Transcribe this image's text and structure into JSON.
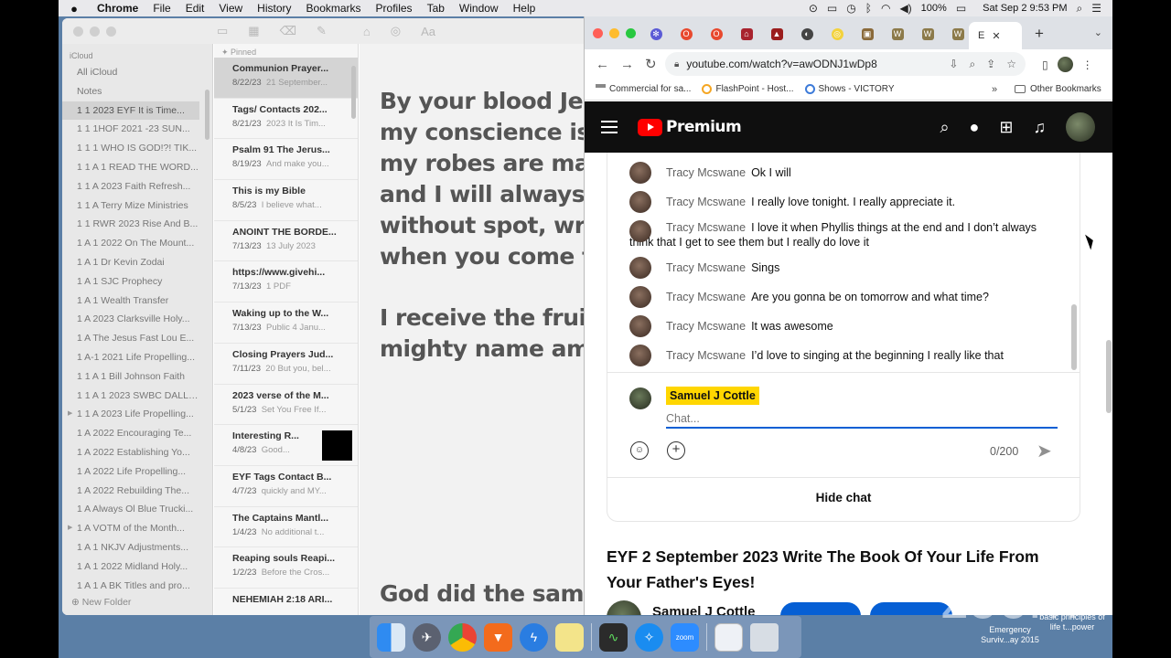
{
  "menubar": {
    "app": "Chrome",
    "menus": [
      "File",
      "Edit",
      "View",
      "History",
      "Bookmarks",
      "Profiles",
      "Tab",
      "Window",
      "Help"
    ],
    "battery": "100%",
    "datetime": "Sat Sep 2  9:53 PM"
  },
  "notes": {
    "account": "iCloud",
    "all_icloud": "All iCloud",
    "notes_folder": "Notes",
    "folders": [
      "1  1  2023 EYF  It is Time...",
      "1  1  1HOF 2021 -23 SUN...",
      "1  1  1 WHO IS GOD!?!  TIK...",
      "1  1 A   1 READ THE WORD...",
      "1  1 A  2023 Faith Refresh...",
      "1  1 A  Terry Mize Ministries",
      "1  1 RWR 2023 Rise And B...",
      "1  A  1 2022 On The Mount...",
      "1  A  1 Dr Kevin Zodai",
      "1  A  1 SJC Prophecy",
      "1  A  1 Wealth Transfer",
      "1  A  2023 Clarksville Holy...",
      "1  A  The Jesus Fast Lou E...",
      "1  A-1 2021 Life Propelling...",
      "1 1 A  1 Bill Johnson Faith",
      "1 1 A 1 2023 SWBC DALLAS",
      "1 1 A 2023 Life Propelling...",
      "1  A   2022 Encouraging Te...",
      "1  A   2022 Establishing Yo...",
      "1  A   2022 Life Propelling...",
      "1  A   2022 Rebuilding The...",
      "1  A   Always Ol Blue Trucki...",
      "1  A   VOTM of the Month...",
      "1  A  1   NKJV Adjustments...",
      "1  A  1   2022 Midland Holy...",
      "1  A  1  A BK Titles and pro..."
    ],
    "new_folder": "New Folder",
    "pinned_label": "Pinned",
    "list": [
      {
        "title": "Communion Prayer...",
        "date": "8/22/23",
        "preview": "21 September..."
      },
      {
        "title": "Tags/ Contacts 202...",
        "date": "8/21/23",
        "preview": "2023 It Is Tim..."
      },
      {
        "title": "Psalm 91 The Jerus...",
        "date": "8/19/23",
        "preview": "And make you..."
      },
      {
        "title": "This is my Bible",
        "date": "8/5/23",
        "preview": "I believe what..."
      },
      {
        "title": "ANOINT THE BORDE...",
        "date": "7/13/23",
        "preview": "13 July 2023"
      },
      {
        "title": "https://www.givehi...",
        "date": "7/13/23",
        "preview": "1 PDF"
      },
      {
        "title": "Waking up to the W...",
        "date": "7/13/23",
        "preview": "Public 4 Janu..."
      },
      {
        "title": "Closing Prayers Jud...",
        "date": "7/11/23",
        "preview": "20 But you, bel..."
      },
      {
        "title": "2023 verse of the M...",
        "date": "5/1/23",
        "preview": "Set You Free If..."
      },
      {
        "title": "Interesting R...",
        "date": "4/8/23",
        "preview": "Good..."
      },
      {
        "title": "EYF Tags Contact B...",
        "date": "4/7/23",
        "preview": "quickly and MY..."
      },
      {
        "title": "The Captains Mantl...",
        "date": "1/4/23",
        "preview": "No additional t..."
      },
      {
        "title": "Reaping souls Reapi...",
        "date": "1/2/23",
        "preview": "Before the Cros..."
      },
      {
        "title": "NEHEMIAH 2:18 ARI...",
        "date": "",
        "preview": ""
      }
    ],
    "editor_p1": [
      "By your blood Jes",
      "my conscience is",
      "my robes are mad",
      "and I will always l",
      "without spot, wrin",
      "when you come fo"
    ],
    "editor_p2": [
      "I receive the fruit",
      "mighty name ame"
    ],
    "editor_p3": [
      "God did the same"
    ]
  },
  "chrome": {
    "active_tab_label": "E",
    "url": "youtube.com/watch?v=awODNJ1wDp8",
    "bookmarks": [
      "Commercial for sa...",
      "FlashPoint - Host...",
      "Shows - VICTORY"
    ],
    "bookmarks_more": "»",
    "other_bookmarks": "Other Bookmarks"
  },
  "youtube": {
    "brand": "Premium",
    "messages": [
      {
        "author": "Tracy Mcswane",
        "text": "Ok I will"
      },
      {
        "author": "Tracy Mcswane",
        "text": "I really love tonight. I really appreciate it."
      },
      {
        "author": "Tracy Mcswane",
        "text": "I love it when Phyllis things at the end and I don’t always think that I get to see them but I really do love it"
      },
      {
        "author": "Tracy Mcswane",
        "text": "Sings"
      },
      {
        "author": "Tracy Mcswane",
        "text": "Are you gonna be on tomorrow and what time?"
      },
      {
        "author": "Tracy Mcswane",
        "text": "It was awesome"
      },
      {
        "author": "Tracy Mcswane",
        "text": "I’d love to singing at the beginning I really like that"
      }
    ],
    "current_user": "Samuel J Cottle",
    "chat_placeholder": "Chat...",
    "char_count": "0/200",
    "hide_chat": "Hide chat",
    "video_title": "EYF 2 September 2023 Write The Book Of Your Life From Your Father's Eyes!",
    "channel_name": "Samuel J Cottle"
  },
  "overlay": {
    "zoom_watermark": "zoom",
    "desktop_item_1": "basic principles of life t...power",
    "desktop_item_2": "Emergency Surviv...ay 2015"
  }
}
